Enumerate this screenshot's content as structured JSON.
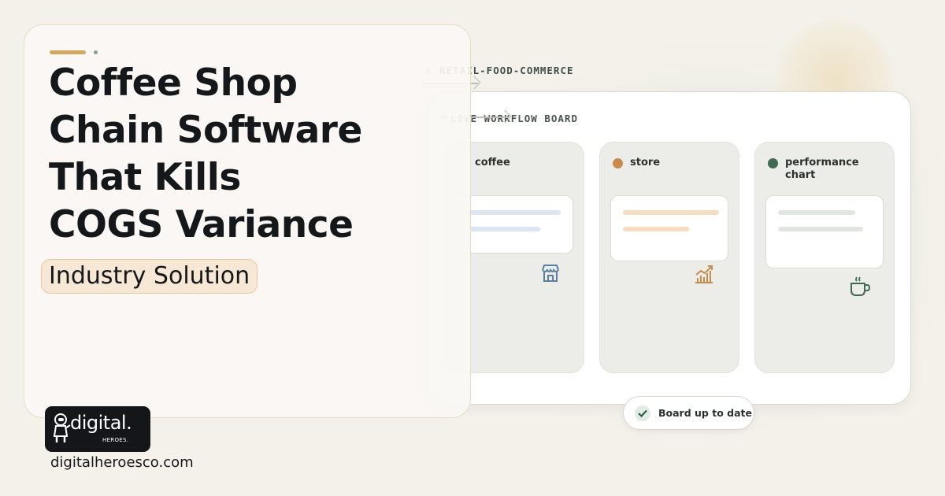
{
  "hero": {
    "headline_lines": [
      "Coffee Shop",
      "Chain Software",
      "That Kills",
      "COGS Variance"
    ],
    "tag": "Industry Solution"
  },
  "eyebrow": "RETAIL-FOOD-COMMERCE",
  "board": {
    "label": "LIVE WORKFLOW BOARD",
    "columns": [
      {
        "title": "coffee",
        "dot_color": "#dfe6f0",
        "icon": "store-icon",
        "bar_color": "#dbe6f0"
      },
      {
        "title": "store",
        "dot_color": "#c98a4b",
        "icon": "chart-icon",
        "bar_color": "#f7dcc2"
      },
      {
        "title": "performance chart",
        "dot_color": "#3f6b55",
        "icon": "coffee-cup-icon",
        "bar_color": "#e0e7e1"
      }
    ],
    "status": "Board up to date"
  },
  "brand": {
    "logo_word": "digital.",
    "logo_sub": "HEROES.",
    "url": "digitalheroesco.com"
  },
  "colors": {
    "accent": "#d1a85e",
    "tag_bg": "#f7e8d6",
    "background": "#f4f1ea"
  }
}
